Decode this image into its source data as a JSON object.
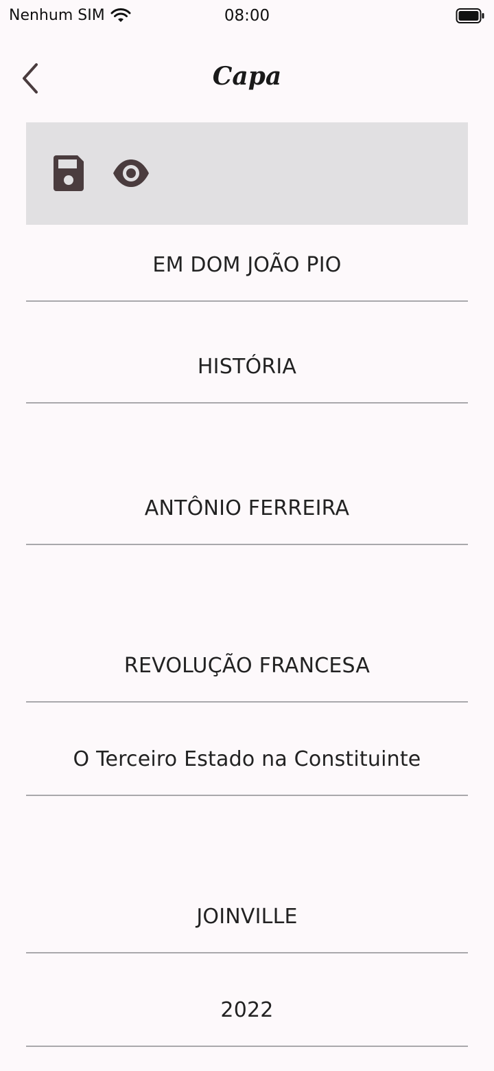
{
  "status_bar": {
    "carrier": "Nenhum SIM",
    "time": "08:00"
  },
  "app_bar": {
    "title": "Capa"
  },
  "toolbar": {
    "background": "#e1e0e2",
    "icon_color": "#4a3c3e",
    "icons": [
      "save-icon",
      "eye-icon"
    ]
  },
  "fields": [
    {
      "value": "EM DOM JOÃO PIO"
    },
    {
      "value": "HISTÓRIA"
    },
    {
      "value": "ANTÔNIO FERREIRA"
    },
    {
      "value": "REVOLUÇÃO FRANCESA"
    },
    {
      "value": "O Terceiro Estado na Constituinte"
    },
    {
      "value": "JOINVILLE"
    },
    {
      "value": "2022"
    }
  ]
}
